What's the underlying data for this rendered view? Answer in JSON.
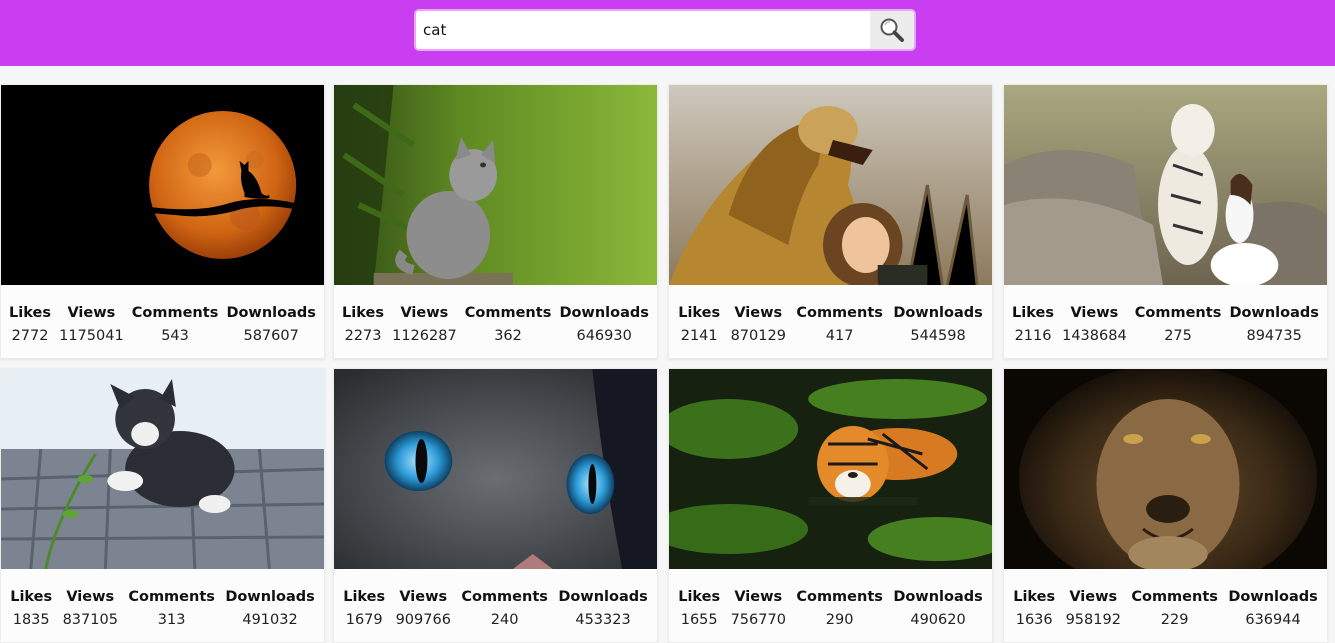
{
  "search": {
    "value": "cat",
    "button_icon": "magnifier-icon"
  },
  "colors": {
    "header": "#ca3ef2",
    "search_border": "#e8a7f4",
    "card_bg": "#fcfcfc"
  },
  "stat_labels": {
    "likes": "Likes",
    "views": "Views",
    "comments": "Comments",
    "downloads": "Downloads"
  },
  "cards": [
    {
      "image": "orange moon with cat silhouette on branch",
      "likes": "2772",
      "views": "1175041",
      "comments": "543",
      "downloads": "587607"
    },
    {
      "image": "grey kitten sitting in green forest",
      "likes": "2273",
      "views": "1126287",
      "comments": "362",
      "downloads": "646930"
    },
    {
      "image": "lion roaring with smiling girl",
      "likes": "2141",
      "views": "870129",
      "comments": "417",
      "downloads": "544598"
    },
    {
      "image": "white tiger and woman on rocks",
      "likes": "2116",
      "views": "1438684",
      "comments": "275",
      "downloads": "894735"
    },
    {
      "image": "black and white kitten playing with plant",
      "likes": "1835",
      "views": "837105",
      "comments": "313",
      "downloads": "491032"
    },
    {
      "image": "close-up of cat with blue eyes",
      "likes": "1679",
      "views": "909766",
      "comments": "240",
      "downloads": "453323"
    },
    {
      "image": "tiger wading in green water",
      "likes": "1655",
      "views": "756770",
      "comments": "290",
      "downloads": "490620"
    },
    {
      "image": "dark lion face portrait",
      "likes": "1636",
      "views": "958192",
      "comments": "229",
      "downloads": "636944"
    }
  ]
}
